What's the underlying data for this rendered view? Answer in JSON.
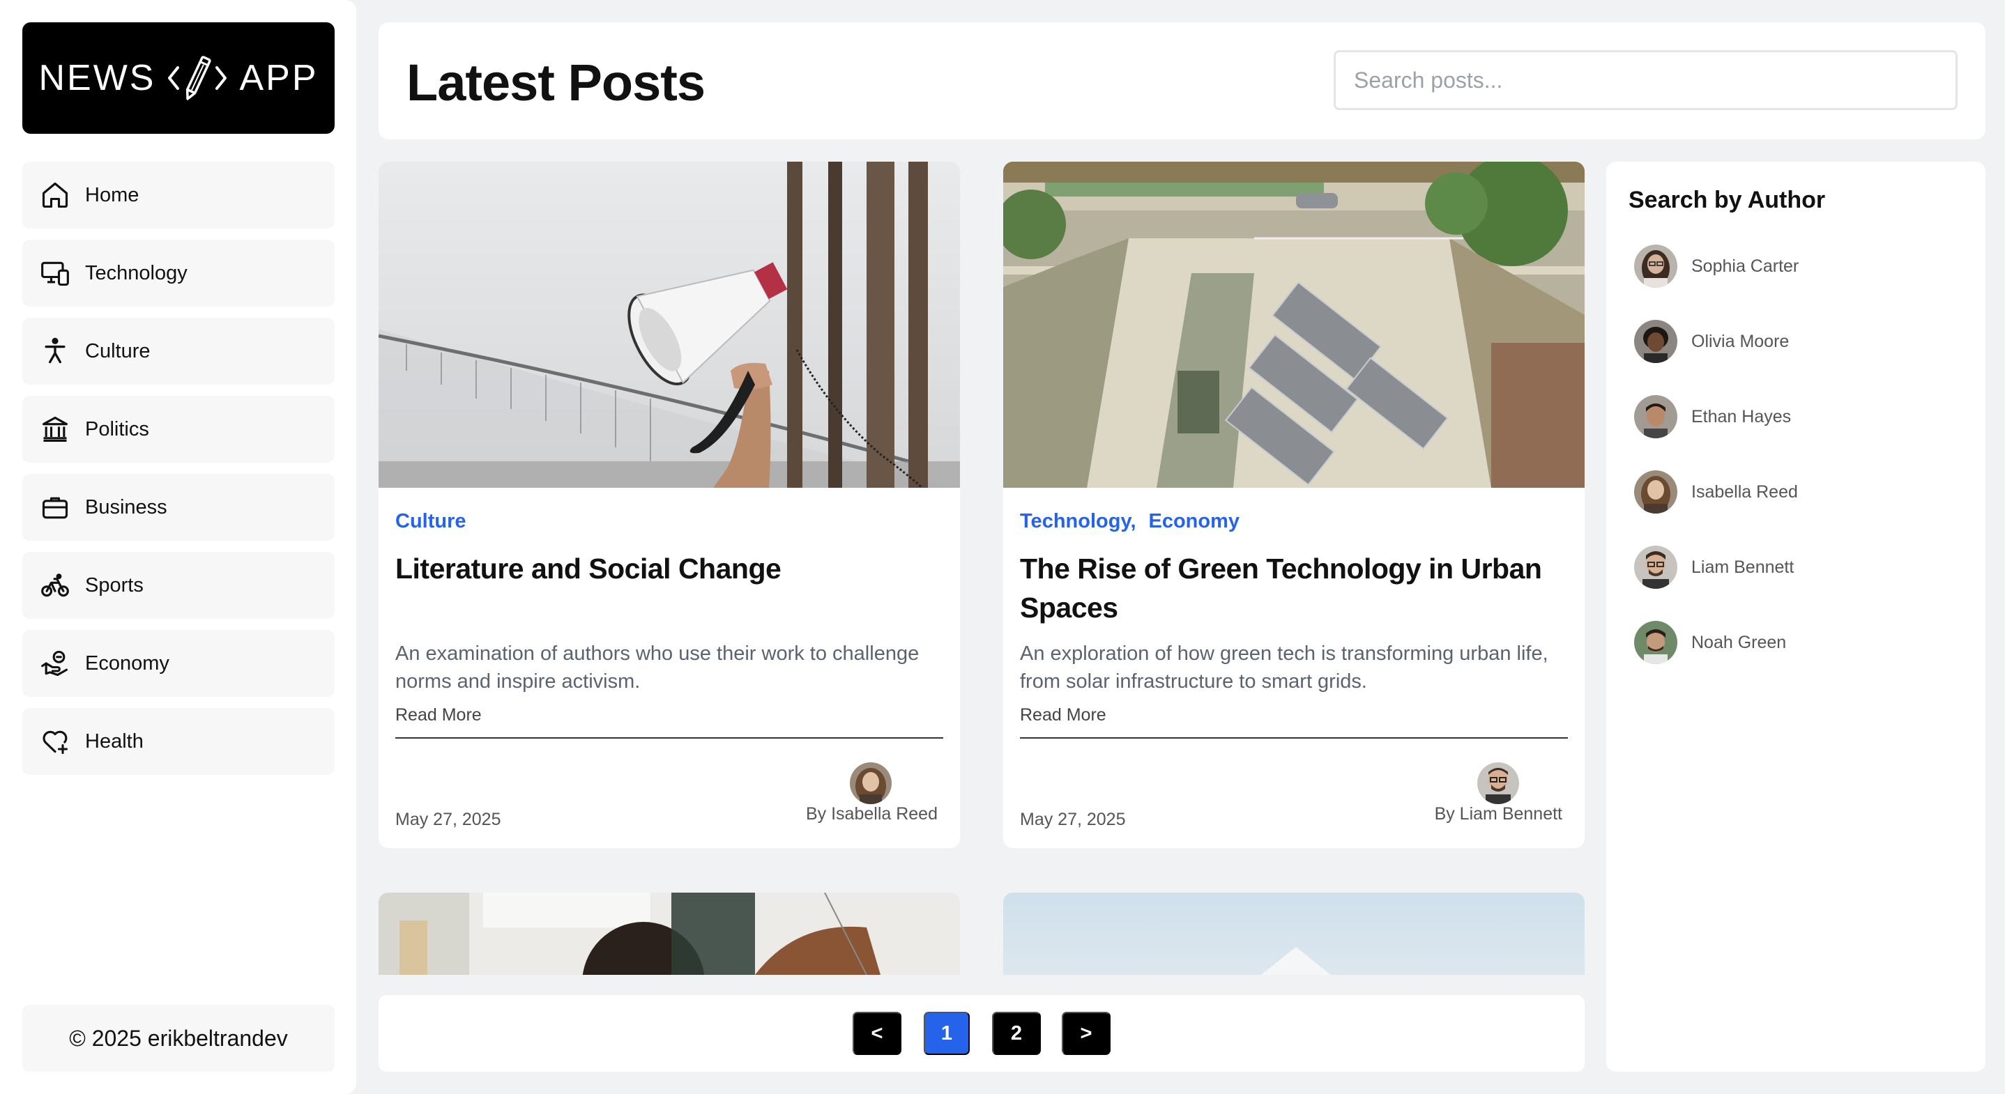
{
  "app": {
    "logo_left": "NEWS",
    "logo_right": "APP"
  },
  "nav": {
    "items": [
      {
        "label": "Home",
        "icon": "home-icon"
      },
      {
        "label": "Technology",
        "icon": "devices-icon"
      },
      {
        "label": "Culture",
        "icon": "person-icon"
      },
      {
        "label": "Politics",
        "icon": "building-columns-icon"
      },
      {
        "label": "Business",
        "icon": "briefcase-icon"
      },
      {
        "label": "Sports",
        "icon": "bicycle-icon"
      },
      {
        "label": "Economy",
        "icon": "coin-hand-icon"
      },
      {
        "label": "Health",
        "icon": "heart-plus-icon"
      }
    ]
  },
  "footer": {
    "text": "© 2025 erikbeltrandev"
  },
  "header": {
    "title": "Latest Posts",
    "search_placeholder": "Search posts..."
  },
  "posts": [
    {
      "categories": [
        "Culture"
      ],
      "title": "Literature and Social Change",
      "description": "An examination of authors who use their work to challenge norms and inspire activism.",
      "read_more": "Read More",
      "date": "May 27, 2025",
      "author": "By Isabella Reed"
    },
    {
      "categories": [
        "Technology",
        "Economy"
      ],
      "separator": ",",
      "title": "The Rise of Green Technology in Urban Spaces",
      "description": "An exploration of how green tech is transforming urban life, from solar infrastructure to smart grids.",
      "read_more": "Read More",
      "date": "May 27, 2025",
      "author": "By Liam Bennett"
    }
  ],
  "pagination": {
    "prev": "<",
    "pages": [
      "1",
      "2"
    ],
    "current": "1",
    "next": ">"
  },
  "authors_panel": {
    "title": "Search by Author",
    "authors": [
      "Sophia Carter",
      "Olivia Moore",
      "Ethan Hayes",
      "Isabella Reed",
      "Liam Bennett",
      "Noah Green"
    ]
  },
  "colors": {
    "accent": "#2563eb",
    "background": "#f1f2f4",
    "logo_bg": "#000000"
  }
}
